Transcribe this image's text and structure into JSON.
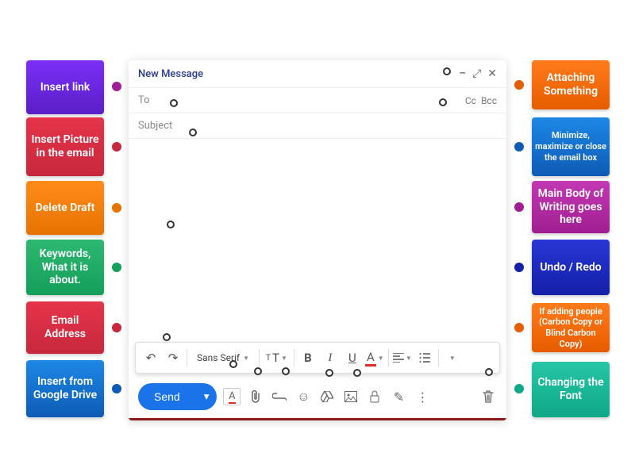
{
  "labels": {
    "insertLink": "Insert link",
    "insertPicture": "Insert Picture in the email",
    "deleteDraft": "Delete Draft",
    "keywords": "Keywords, What it is about.",
    "emailAddress": "Email Address",
    "insertDrive": "Insert from Google Drive",
    "attaching": "Attaching Something",
    "winControls": "Minimize, maximize or close the email box",
    "mainBody": "Main Body of Writing goes here",
    "undoRedo": "Undo / Redo",
    "ccBcc": "If adding people (Carbon Copy or Blind Carbon Copy)",
    "changeFont": "Changing the Font"
  },
  "compose": {
    "title": "New Message",
    "to": "To",
    "subject": "Subject",
    "cc": "Cc",
    "bcc": "Bcc",
    "send": "Send",
    "fontName": "Sans Serif"
  },
  "icons": {
    "undo": "↶",
    "redo": "↷",
    "bold": "B",
    "italic": "I",
    "underline": "U",
    "textColor": "A",
    "minimize": "–",
    "maximize": "⤢",
    "close": "✕",
    "more": "⋮",
    "trash": "🗑",
    "emoji": "☺",
    "confidential": "🔒",
    "pen": "✎",
    "splitTri": "▾"
  }
}
